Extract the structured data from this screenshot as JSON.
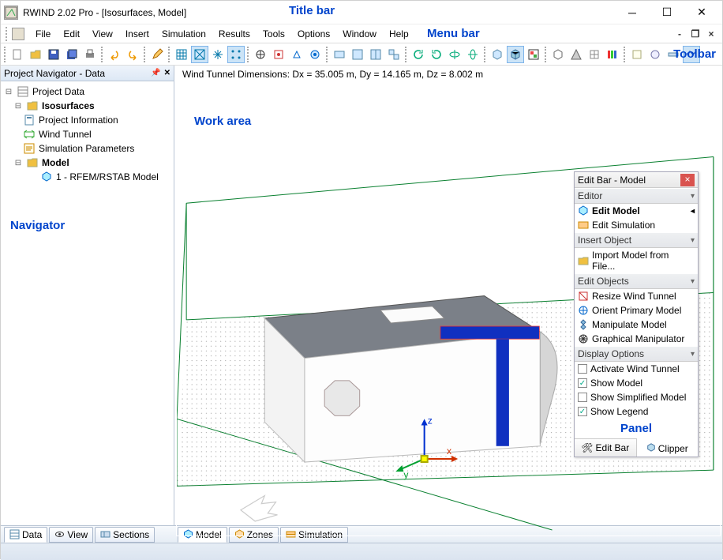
{
  "title_bar": {
    "text": "RWIND 2.02 Pro - [Isosurfaces, Model]"
  },
  "annotations": {
    "title": "Title bar",
    "menu": "Menu bar",
    "toolbar": "Toolbar",
    "navigator": "Navigator",
    "work": "Work area",
    "panel": "Panel"
  },
  "menu": {
    "items": [
      "File",
      "Edit",
      "View",
      "Insert",
      "Simulation",
      "Results",
      "Tools",
      "Options",
      "Window",
      "Help"
    ]
  },
  "navigator": {
    "header": "Project Navigator - Data",
    "tree": {
      "root": "Project Data",
      "iso": "Isosurfaces",
      "pi": "Project Information",
      "wt": "Wind Tunnel",
      "sp": "Simulation Parameters",
      "model": "Model",
      "rfem": "1 - RFEM/RSTAB Model"
    },
    "tabs": [
      "Data",
      "View",
      "Sections"
    ]
  },
  "workarea": {
    "info": "Wind Tunnel Dimensions: Dx = 35.005 m, Dy = 14.165 m, Dz = 8.002 m",
    "tabs": [
      "Model",
      "Zones",
      "Simulation"
    ]
  },
  "panel": {
    "title": "Edit Bar - Model",
    "sections": {
      "editor": "Editor",
      "insert": "Insert Object",
      "edit": "Edit Objects",
      "display": "Display Options"
    },
    "items": {
      "edit_model": "Edit Model",
      "edit_sim": "Edit Simulation",
      "import": "Import Model from File...",
      "resize_wt": "Resize Wind Tunnel",
      "orient": "Orient Primary Model",
      "manipulate": "Manipulate Model",
      "gmanip": "Graphical Manipulator",
      "activate_wt": "Activate Wind Tunnel",
      "show_model": "Show Model",
      "show_simp": "Show Simplified Model",
      "show_legend": "Show Legend"
    },
    "checks": {
      "activate_wt": false,
      "show_model": true,
      "show_simp": false,
      "show_legend": true
    },
    "tabs": {
      "editbar": "Edit Bar",
      "clipper": "Clipper"
    }
  }
}
